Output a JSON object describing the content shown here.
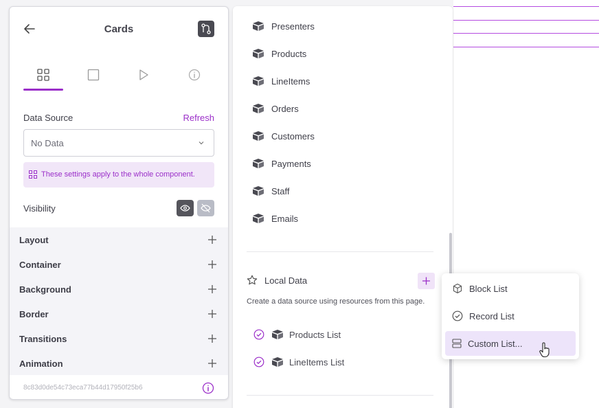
{
  "panel": {
    "title": "Cards",
    "data_source_label": "Data Source",
    "refresh_label": "Refresh",
    "select_value": "No Data",
    "note": "These settings apply to the whole component.",
    "visibility_label": "Visibility",
    "sections": [
      "Layout",
      "Container",
      "Background",
      "Border",
      "Transitions",
      "Animation"
    ],
    "component_id": "8c83d0de54c73eca77b44d17950f25b6"
  },
  "resources": [
    "Presenters",
    "Products",
    "LineItems",
    "Orders",
    "Customers",
    "Payments",
    "Staff",
    "Emails"
  ],
  "local_data": {
    "title": "Local Data",
    "description": "Create a data source using resources from this page.",
    "items": [
      "Products List",
      "LineItems List"
    ]
  },
  "menu": {
    "items": [
      "Block List",
      "Record List",
      "Custom List..."
    ]
  },
  "colors": {
    "accent": "#9b2fc9",
    "canvas_line": "#b44be0"
  }
}
